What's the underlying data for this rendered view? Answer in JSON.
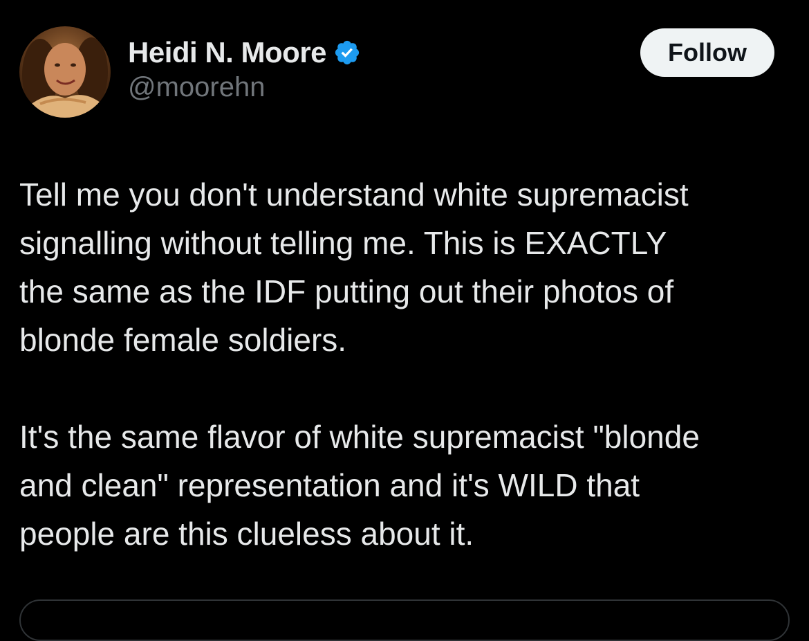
{
  "author": {
    "display_name": "Heidi N. Moore",
    "handle": "@moorehn",
    "verified": true,
    "verified_color": "#1d9bf0"
  },
  "actions": {
    "follow_label": "Follow"
  },
  "tweet": {
    "paragraphs": [
      "Tell me you don't understand white supremacist\nsignalling without telling me. This is EXACTLY\nthe same as the IDF putting out their photos of\nblonde female soldiers.",
      "It's the same flavor of white supremacist \"blonde\nand clean\" representation and it's WILD that\npeople are this clueless about it."
    ]
  },
  "colors": {
    "background": "#000000",
    "text_primary": "#e7e9ea",
    "text_secondary": "#71767b",
    "button_bg": "#eff3f4"
  }
}
